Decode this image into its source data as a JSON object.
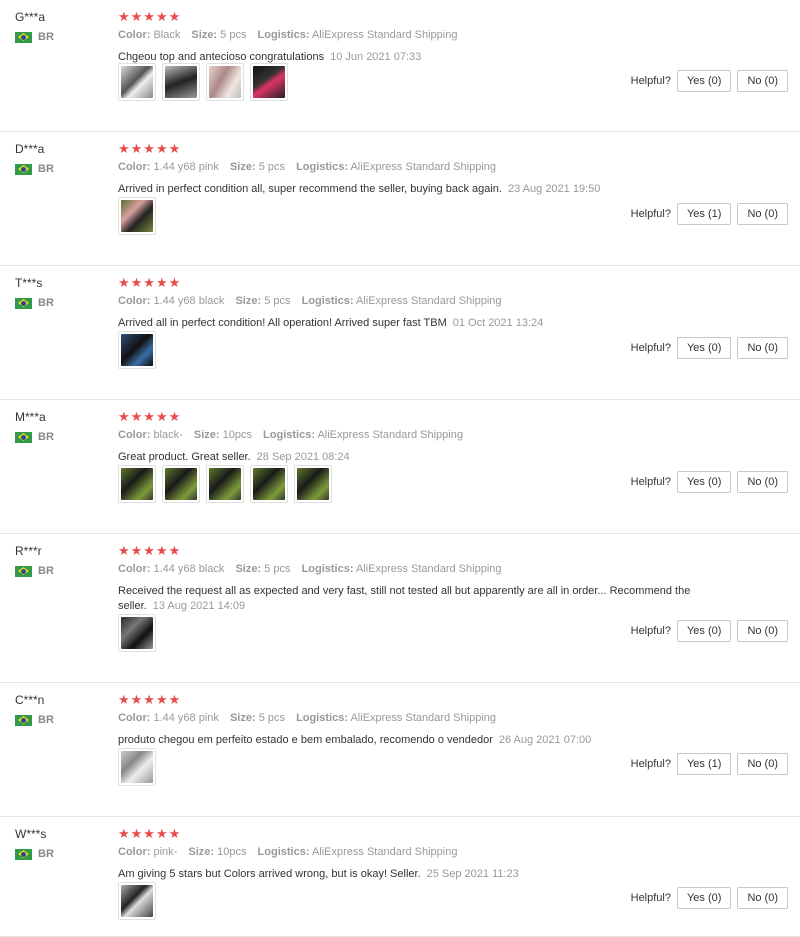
{
  "ui": {
    "helpful_label": "Helpful?",
    "color_label": "Color:",
    "size_label": "Size:",
    "logistics_label": "Logistics:",
    "star_color": "#e84b4b"
  },
  "reviews": [
    {
      "user": "G***a",
      "country": "BR",
      "stars": "★★★★★",
      "color": "Black",
      "size": "5 pcs",
      "logistics": "AliExpress Standard Shipping",
      "text": "Chgeou top and antecioso congratulations",
      "date": "10 Jun 2021 07:33",
      "yes": "Yes (0)",
      "no": "No (0)",
      "photos": [
        "ph-a",
        "ph-b",
        "ph-c",
        "ph-d"
      ]
    },
    {
      "user": "D***a",
      "country": "BR",
      "stars": "★★★★★",
      "color": "1.44 y68 pink",
      "size": "5 pcs",
      "logistics": "AliExpress Standard Shipping",
      "text": "Arrived in perfect condition all, super recommend the seller, buying back again.",
      "date": "23 Aug 2021 19:50",
      "yes": "Yes (1)",
      "no": "No (0)",
      "photos": [
        "ph-e"
      ]
    },
    {
      "user": "T***s",
      "country": "BR",
      "stars": "★★★★★",
      "color": "1.44 y68 black",
      "size": "5 pcs",
      "logistics": "AliExpress Standard Shipping",
      "text": "Arrived all in perfect condition! All operation! Arrived super fast TBM",
      "date": "01 Oct 2021 13:24",
      "yes": "Yes (0)",
      "no": "No (0)",
      "photos": [
        "ph-f"
      ]
    },
    {
      "user": "M***a",
      "country": "BR",
      "stars": "★★★★★",
      "color": "black-",
      "size": "10pcs",
      "logistics": "AliExpress Standard Shipping",
      "text": "Great product. Great seller.",
      "date": "28 Sep 2021 08:24",
      "yes": "Yes (0)",
      "no": "No (0)",
      "photos": [
        "ph-g",
        "ph-g",
        "ph-g",
        "ph-g",
        "ph-g"
      ]
    },
    {
      "user": "R***r",
      "country": "BR",
      "stars": "★★★★★",
      "color": "1.44 y68 black",
      "size": "5 pcs",
      "logistics": "AliExpress Standard Shipping",
      "text": "Received the request all as expected and very fast, still not tested all but apparently are all in order... Recommend the seller.",
      "date": "13 Aug 2021 14:09",
      "yes": "Yes (0)",
      "no": "No (0)",
      "photos": [
        "ph-h"
      ]
    },
    {
      "user": "C***n",
      "country": "BR",
      "stars": "★★★★★",
      "color": "1.44 y68 pink",
      "size": "5 pcs",
      "logistics": "AliExpress Standard Shipping",
      "text": "produto chegou em perfeito estado e bem embalado, recomendo o vendedor",
      "date": "26 Aug 2021 07:00",
      "yes": "Yes (1)",
      "no": "No (0)",
      "photos": [
        "ph-i"
      ]
    },
    {
      "user": "W***s",
      "country": "BR",
      "stars": "★★★★★",
      "color": "pink-",
      "size": "10pcs",
      "logistics": "AliExpress Standard Shipping",
      "text": "Am giving 5 stars but Colors arrived wrong, but is okay! Seller.",
      "date": "25 Sep 2021 11:23",
      "yes": "Yes (0)",
      "no": "No (0)",
      "photos": [
        "ph-j"
      ]
    }
  ]
}
